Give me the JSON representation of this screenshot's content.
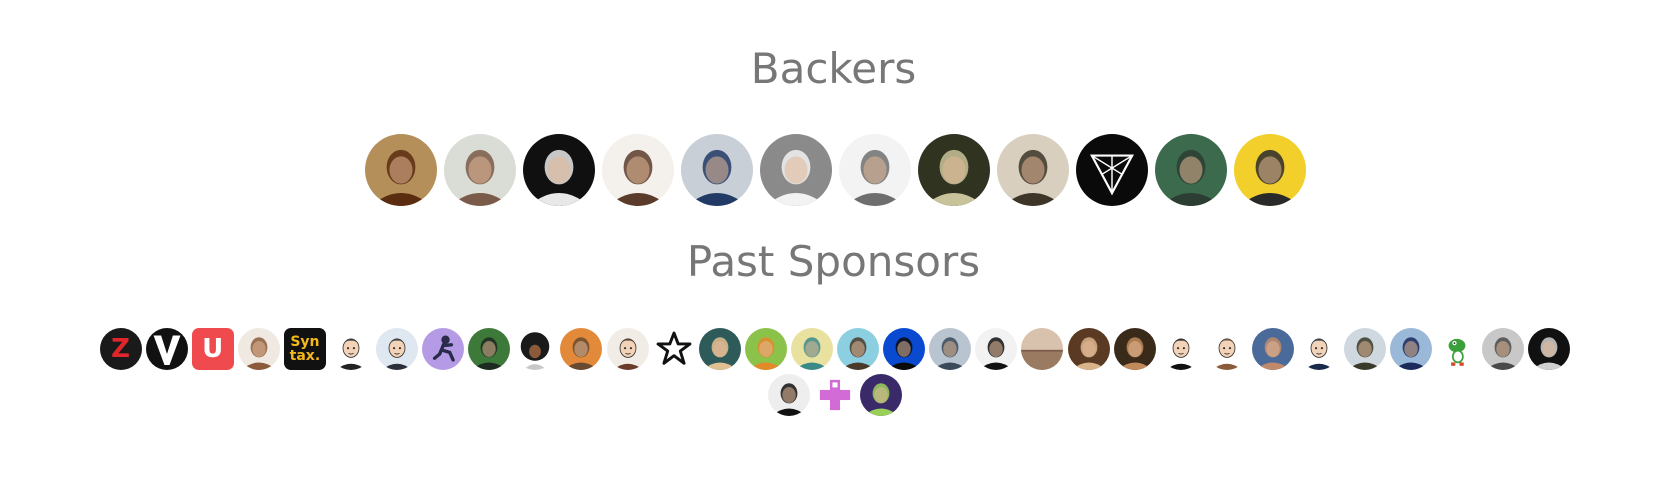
{
  "backers": {
    "title": "Backers",
    "avatars": [
      {
        "name": "backer-1",
        "bg": "#b58f5a",
        "fg": "#5a2d10",
        "kind": "face"
      },
      {
        "name": "backer-2",
        "bg": "#d9ddd6",
        "fg": "#7a5a48",
        "kind": "face"
      },
      {
        "name": "backer-3",
        "bg": "#101010",
        "fg": "#e8e8e8",
        "kind": "face"
      },
      {
        "name": "backer-4",
        "bg": "#f4f0ec",
        "fg": "#5b3b2a",
        "kind": "face"
      },
      {
        "name": "backer-5",
        "bg": "#c9cfd6",
        "fg": "#213a66",
        "kind": "face"
      },
      {
        "name": "backer-6",
        "bg": "#8a8a8a",
        "fg": "#f2f2f2",
        "kind": "face"
      },
      {
        "name": "backer-7",
        "bg": "#f3f3f3",
        "fg": "#6e6e6e",
        "kind": "face"
      },
      {
        "name": "backer-8",
        "bg": "#2f3320",
        "fg": "#c8c39a",
        "kind": "face"
      },
      {
        "name": "backer-9",
        "bg": "#d8cfbf",
        "fg": "#3d3528",
        "kind": "face"
      },
      {
        "name": "backer-10",
        "bg": "#0a0a0a",
        "fg": "#ffffff",
        "kind": "triangle-logo"
      },
      {
        "name": "backer-11",
        "bg": "#3c6a4c",
        "fg": "#2c3d33",
        "kind": "face"
      },
      {
        "name": "backer-12",
        "bg": "#f2cf2a",
        "fg": "#2a2a2a",
        "kind": "face"
      }
    ]
  },
  "past_sponsors": {
    "title": "Past Sponsors",
    "avatars": [
      {
        "name": "sponsor-1",
        "bg": "#1a1a1a",
        "fg": "#e0262b",
        "kind": "letter",
        "letter": "Z"
      },
      {
        "name": "sponsor-2",
        "bg": "#111111",
        "fg": "#ffffff",
        "kind": "v-logo"
      },
      {
        "name": "sponsor-3",
        "bg": "#ef4b4f",
        "fg": "#ffffff",
        "kind": "letter",
        "letter": "U",
        "square": true
      },
      {
        "name": "sponsor-4",
        "bg": "#efe9e2",
        "fg": "#8a5a3a",
        "kind": "face"
      },
      {
        "name": "sponsor-5",
        "bg": "#111111",
        "fg": "#f3b81a",
        "kind": "syntax",
        "line1": "Syn",
        "line2": "tax.",
        "square": true
      },
      {
        "name": "sponsor-6",
        "bg": "#ffffff",
        "fg": "#222222",
        "kind": "cartoon"
      },
      {
        "name": "sponsor-7",
        "bg": "#dfe7f0",
        "fg": "#2a2f3a",
        "kind": "cartoon"
      },
      {
        "name": "sponsor-8",
        "bg": "#b59be6",
        "fg": "#2a2a4a",
        "kind": "runner"
      },
      {
        "name": "sponsor-9",
        "bg": "#3d7a3a",
        "fg": "#1d2a20",
        "kind": "face"
      },
      {
        "name": "sponsor-10",
        "bg": "#ffffff",
        "fg": "#1a1a1a",
        "kind": "afro"
      },
      {
        "name": "sponsor-11",
        "bg": "#e38a3a",
        "fg": "#6a4a30",
        "kind": "face"
      },
      {
        "name": "sponsor-12",
        "bg": "#f1ece6",
        "fg": "#6a3a2a",
        "kind": "cartoon"
      },
      {
        "name": "sponsor-13",
        "bg": "#ffffff",
        "fg": "#111111",
        "kind": "star"
      },
      {
        "name": "sponsor-14",
        "bg": "#2e5a5a",
        "fg": "#e0c090",
        "kind": "face"
      },
      {
        "name": "sponsor-15",
        "bg": "#8bc34a",
        "fg": "#e28a2a",
        "kind": "face"
      },
      {
        "name": "sponsor-16",
        "bg": "#e9e1a0",
        "fg": "#3a8a8a",
        "kind": "face"
      },
      {
        "name": "sponsor-17",
        "bg": "#8ccfe0",
        "fg": "#4a3a2a",
        "kind": "face"
      },
      {
        "name": "sponsor-18",
        "bg": "#0a4ad0",
        "fg": "#0a0a0a",
        "kind": "face"
      },
      {
        "name": "sponsor-19",
        "bg": "#b8c4d0",
        "fg": "#3a4a5a",
        "kind": "face"
      },
      {
        "name": "sponsor-20",
        "bg": "#f2f2f2",
        "fg": "#111111",
        "kind": "face"
      },
      {
        "name": "sponsor-21",
        "bg": "#d9c2ad",
        "fg": "#9a7a60",
        "kind": "landscape"
      },
      {
        "name": "sponsor-22",
        "bg": "#5a3a22",
        "fg": "#d9b48a",
        "kind": "face"
      },
      {
        "name": "sponsor-23",
        "bg": "#3a2a1a",
        "fg": "#c08a5a",
        "kind": "face"
      },
      {
        "name": "sponsor-24",
        "bg": "#ffffff",
        "fg": "#111111",
        "kind": "cartoon"
      },
      {
        "name": "sponsor-25",
        "bg": "#ffffff",
        "fg": "#8a5a3a",
        "kind": "cartoon"
      },
      {
        "name": "sponsor-26",
        "bg": "#4a6a9a",
        "fg": "#c08a6a",
        "kind": "face"
      },
      {
        "name": "sponsor-27",
        "bg": "#ffffff",
        "fg": "#1a2a4a",
        "kind": "cartoon"
      },
      {
        "name": "sponsor-28",
        "bg": "#cfd8de",
        "fg": "#3a3a2a",
        "kind": "face"
      },
      {
        "name": "sponsor-29",
        "bg": "#9ab8d8",
        "fg": "#1a2a5a",
        "kind": "face"
      },
      {
        "name": "sponsor-30",
        "bg": "#ffffff",
        "fg": "#3aa03a",
        "kind": "yoshi"
      },
      {
        "name": "sponsor-31",
        "bg": "#c8c8c8",
        "fg": "#4a4a4a",
        "kind": "face"
      },
      {
        "name": "sponsor-32",
        "bg": "#111111",
        "fg": "#d0d0d0",
        "kind": "face"
      },
      {
        "name": "sponsor-33",
        "bg": "#eeeeee",
        "fg": "#111111",
        "kind": "face"
      },
      {
        "name": "sponsor-34",
        "bg": "#ffffff",
        "fg": "#d36bd6",
        "kind": "plus-logo"
      },
      {
        "name": "sponsor-35",
        "bg": "#3a2a6a",
        "fg": "#9ad05a",
        "kind": "face"
      }
    ]
  }
}
